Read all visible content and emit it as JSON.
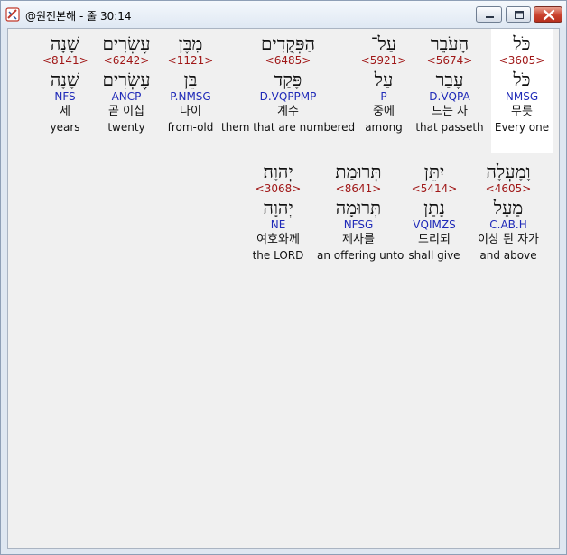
{
  "window": {
    "title": "@원전본해 - 줄 30:14"
  },
  "rows": [
    {
      "words": [
        {
          "heb": "כֹּל",
          "strong": "<3605>",
          "lemma": "כֹּל",
          "morph": "NMSG",
          "kor": "무릇",
          "eng": "Every one"
        },
        {
          "heb": "הָעֹבֵר",
          "strong": "<5674>",
          "lemma": "עָבַר",
          "morph": "D.VQPA",
          "kor": "드는 자",
          "eng": "that passeth"
        },
        {
          "heb": "עַל־",
          "strong": "<5921>",
          "lemma": "עַל",
          "morph": "P",
          "kor": "중에",
          "eng": "among"
        },
        {
          "heb": "הַפְּקֻדִים",
          "strong": "<6485>",
          "lemma": "פָּקַד",
          "morph": "D.VQPPMP",
          "kor": "계수",
          "eng": "them that are numbered"
        },
        {
          "heb": "מִבֶּן",
          "strong": "<1121>",
          "lemma": "בֵּן",
          "morph": "P.NMSG",
          "kor": "나이",
          "eng": "from-old"
        },
        {
          "heb": "עֶשְׂרִים",
          "strong": "<6242>",
          "lemma": "עֶשְׂרִים",
          "morph": "ANCP",
          "kor": "곧 이십",
          "eng": "twenty"
        },
        {
          "heb": "שָׁנָה",
          "strong": "<8141>",
          "lemma": "שָׁנָה",
          "morph": "NFS",
          "kor": "세",
          "eng": "years"
        }
      ]
    },
    {
      "words": [
        {
          "heb": "וָמָעְלָה",
          "strong": "<4605>",
          "lemma": "מַעַל",
          "morph": "C.AB.H",
          "kor": "이상 된 자가",
          "eng": "and above"
        },
        {
          "heb": "יִתֵּן",
          "strong": "<5414>",
          "lemma": "נָתַן",
          "morph": "VQIMZS",
          "kor": "드리되",
          "eng": "shall give"
        },
        {
          "heb": "תְּרוּמַת",
          "strong": "<8641>",
          "lemma": "תְּרוּמָה",
          "morph": "NFSG",
          "kor": "제사를",
          "eng": "an offering unto"
        },
        {
          "heb": "יְהוָה׃",
          "strong": "<3068>",
          "lemma": "יְהוָה",
          "morph": "NE",
          "kor": "여호와께",
          "eng": "the LORD"
        }
      ]
    }
  ]
}
